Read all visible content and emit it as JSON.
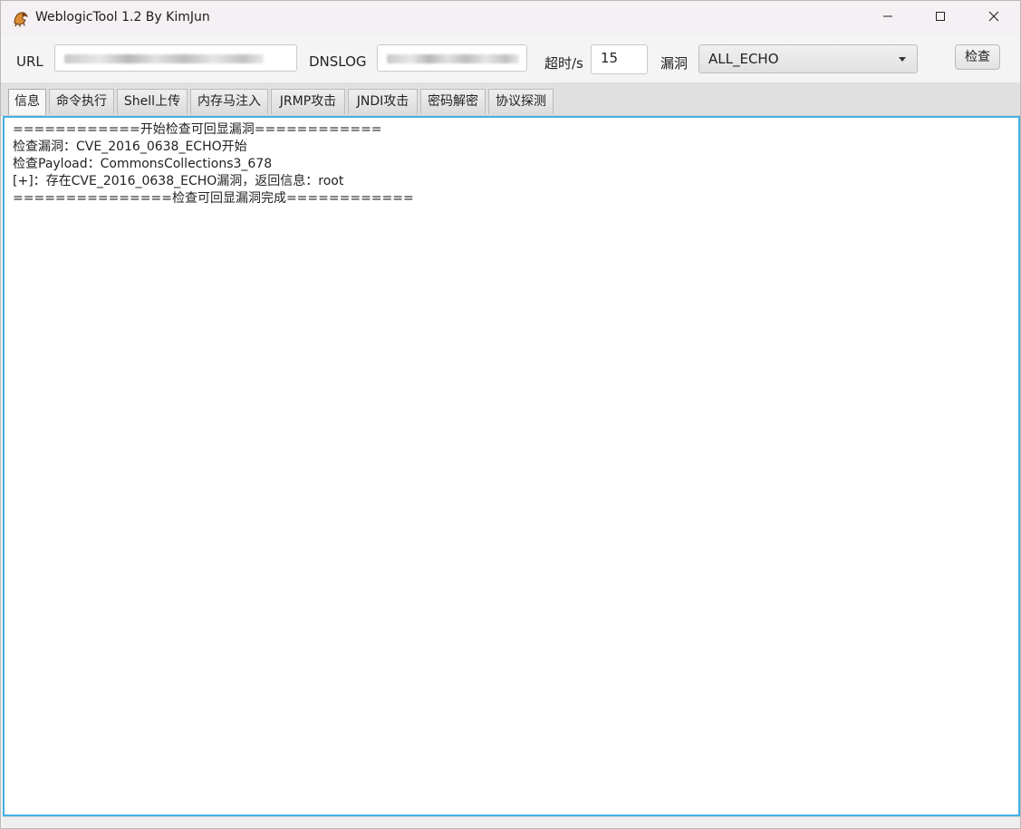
{
  "window": {
    "title": "WeblogicTool 1.2 By KimJun",
    "icon": "weblogic-app-icon"
  },
  "controls": {
    "minimize_icon": "minimize-icon",
    "maximize_icon": "maximize-icon",
    "close_icon": "close-icon"
  },
  "toolbar": {
    "url_label": "URL",
    "url_value": "",
    "dnslog_label": "DNSLOG",
    "dnslog_value": "",
    "timeout_label": "超时/s",
    "timeout_value": "15",
    "vuln_label": "漏洞",
    "vuln_selected": "ALL_ECHO",
    "check_button": "检查"
  },
  "tabs": [
    {
      "label": "信息",
      "active": true
    },
    {
      "label": "命令执行",
      "active": false
    },
    {
      "label": "Shell上传",
      "active": false
    },
    {
      "label": "内存马注入",
      "active": false
    },
    {
      "label": "JRMP攻击",
      "active": false
    },
    {
      "label": "JNDI攻击",
      "active": false
    },
    {
      "label": "密码解密",
      "active": false
    },
    {
      "label": "协议探测",
      "active": false
    }
  ],
  "output": {
    "lines": [
      "============开始检查可回显漏洞============",
      "检查漏洞：CVE_2016_0638_ECHO开始",
      "检查Payload：CommonsCollections3_678",
      "[+]：存在CVE_2016_0638_ECHO漏洞，返回信息：root",
      "===============检查可回显漏洞完成============"
    ]
  },
  "colors": {
    "accent_border": "#44b0e3",
    "titlebar_bg": "#f5f0f3"
  }
}
